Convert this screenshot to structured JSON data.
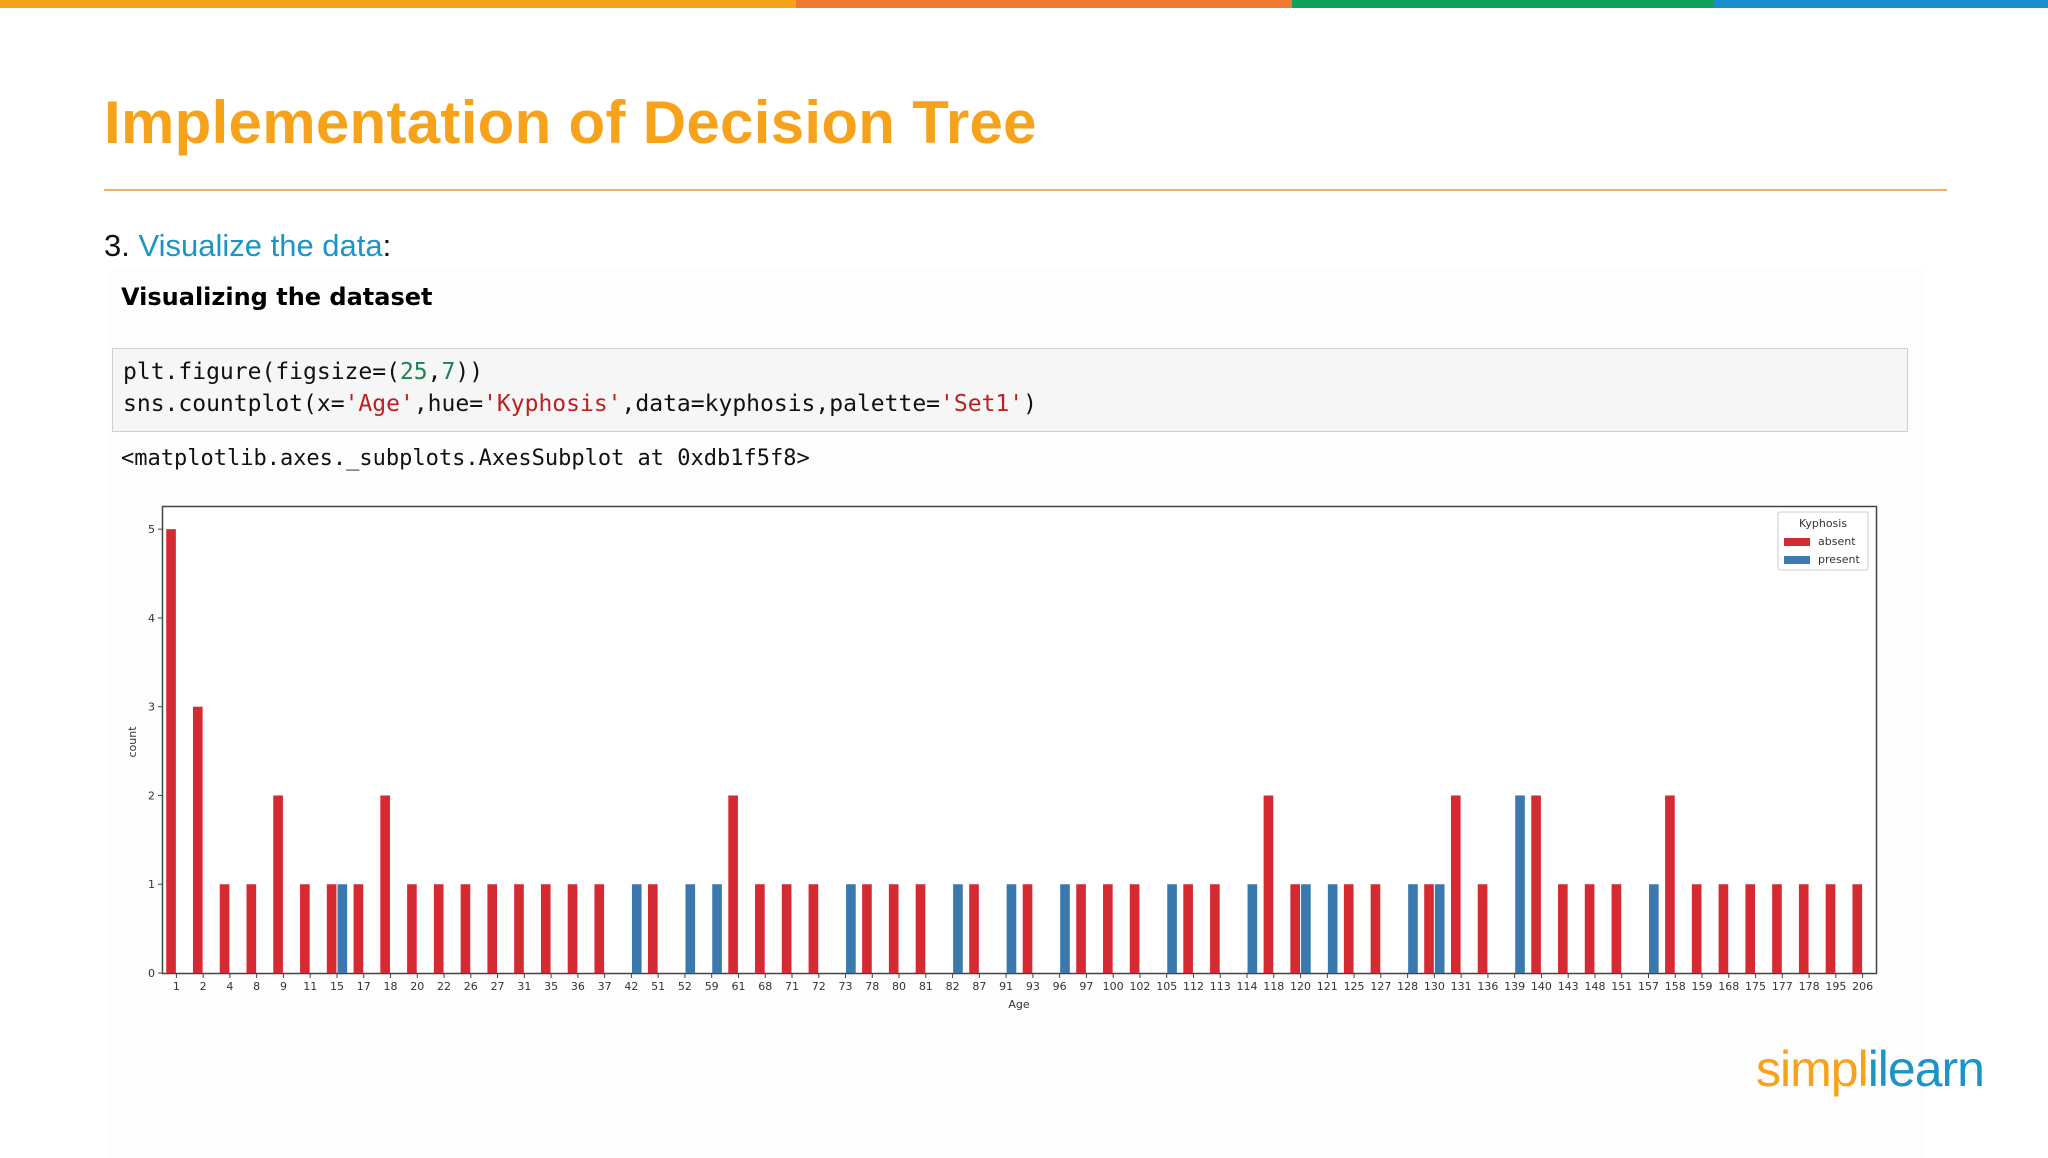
{
  "slide": {
    "title": "Implementation of Decision Tree",
    "step_number": "3.",
    "step_link": "Visualize the data",
    "step_suffix": ":",
    "top_bar_colors": [
      "#F7A21B",
      "#EE7930",
      "#12A15A",
      "#1B8CCC"
    ],
    "title_color": "#F7A21B",
    "link_color": "#1E93C6"
  },
  "notebook": {
    "heading": "Visualizing the dataset",
    "code": {
      "line1": {
        "p1": "plt.figure(figsize=(",
        "n1": "25",
        "p2": ",",
        "n2": "7",
        "p3": "))"
      },
      "line2": {
        "p1": "sns.countplot(x=",
        "s1": "'Age'",
        "p2": ",hue=",
        "s2": "'Kyphosis'",
        "p3": ",data=kyphosis,palette=",
        "s3": "'Set1'",
        "p4": ")"
      }
    },
    "output": "<matplotlib.axes._subplots.AxesSubplot at 0xdb1f5f8>"
  },
  "chart_data": {
    "type": "bar",
    "xlabel": "Age",
    "ylabel": "count",
    "ylim": [
      0,
      5.25
    ],
    "yticks": [
      0,
      1,
      2,
      3,
      4,
      5
    ],
    "legend_title": "Kyphosis",
    "legend_position": "top-right",
    "categories": [
      "1",
      "2",
      "4",
      "8",
      "9",
      "11",
      "15",
      "17",
      "18",
      "20",
      "22",
      "26",
      "27",
      "31",
      "35",
      "36",
      "37",
      "42",
      "51",
      "52",
      "59",
      "61",
      "68",
      "71",
      "72",
      "73",
      "78",
      "80",
      "81",
      "82",
      "87",
      "91",
      "93",
      "96",
      "97",
      "100",
      "102",
      "105",
      "112",
      "113",
      "114",
      "118",
      "120",
      "121",
      "125",
      "127",
      "128",
      "130",
      "131",
      "136",
      "139",
      "140",
      "143",
      "148",
      "151",
      "157",
      "158",
      "159",
      "168",
      "175",
      "177",
      "178",
      "195",
      "206"
    ],
    "series": [
      {
        "name": "absent",
        "color": "#D62A33",
        "values": [
          5,
          3,
          1,
          1,
          2,
          1,
          1,
          1,
          2,
          1,
          1,
          1,
          1,
          1,
          1,
          1,
          1,
          0,
          1,
          0,
          0,
          2,
          1,
          1,
          1,
          0,
          1,
          1,
          1,
          0,
          1,
          0,
          1,
          0,
          1,
          1,
          1,
          0,
          1,
          1,
          0,
          2,
          1,
          0,
          1,
          1,
          0,
          1,
          2,
          1,
          0,
          2,
          1,
          1,
          1,
          0,
          2,
          1,
          1,
          1,
          1,
          1,
          1,
          1
        ]
      },
      {
        "name": "present",
        "color": "#3B78AE",
        "values": [
          0,
          0,
          0,
          0,
          0,
          0,
          1,
          0,
          0,
          0,
          0,
          0,
          0,
          0,
          0,
          0,
          0,
          1,
          0,
          1,
          1,
          0,
          0,
          0,
          0,
          1,
          0,
          0,
          0,
          1,
          0,
          1,
          0,
          1,
          0,
          0,
          0,
          1,
          0,
          0,
          1,
          0,
          1,
          1,
          0,
          0,
          1,
          1,
          0,
          0,
          2,
          0,
          0,
          0,
          0,
          1,
          0,
          0,
          0,
          0,
          0,
          0,
          0,
          0
        ]
      }
    ]
  },
  "logo": {
    "part1": "simpl",
    "part2": "ilearn"
  }
}
